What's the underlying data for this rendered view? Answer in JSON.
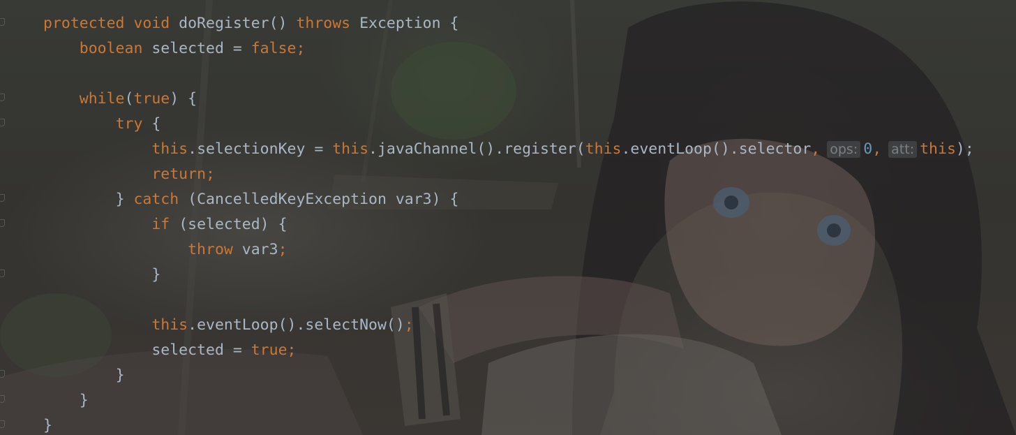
{
  "editor": {
    "colors": {
      "keyword": "#cc7832",
      "text": "#a9b7c6",
      "number": "#6897bb",
      "inlay_hint": "#7a8086",
      "background": "#2b2b2b"
    },
    "lines": [
      {
        "indent": "",
        "tokens": [
          {
            "t": "protected void ",
            "c": "kw"
          },
          {
            "t": "doRegister() ",
            "c": "plain"
          },
          {
            "t": "throws ",
            "c": "kw"
          },
          {
            "t": "Exception {",
            "c": "plain"
          }
        ]
      },
      {
        "indent": "    ",
        "tokens": [
          {
            "t": "boolean ",
            "c": "kw"
          },
          {
            "t": "selected = ",
            "c": "plain"
          },
          {
            "t": "false;",
            "c": "kw"
          }
        ]
      },
      {
        "indent": "",
        "tokens": []
      },
      {
        "indent": "    ",
        "tokens": [
          {
            "t": "while",
            "c": "kw"
          },
          {
            "t": "(",
            "c": "plain"
          },
          {
            "t": "true",
            "c": "kw"
          },
          {
            "t": ") {",
            "c": "plain"
          }
        ]
      },
      {
        "indent": "        ",
        "tokens": [
          {
            "t": "try ",
            "c": "kw"
          },
          {
            "t": "{",
            "c": "plain"
          }
        ]
      },
      {
        "indent": "            ",
        "tokens": [
          {
            "t": "this",
            "c": "kw"
          },
          {
            "t": ".selectionKey = ",
            "c": "plain"
          },
          {
            "t": "this",
            "c": "kw"
          },
          {
            "t": ".javaChannel().register(",
            "c": "plain"
          },
          {
            "t": "this",
            "c": "kw"
          },
          {
            "t": ".eventLoop().selector",
            "c": "plain"
          },
          {
            "t": ",",
            "c": "kw"
          },
          {
            "t": "ops:",
            "c": "hint"
          },
          {
            "t": "0",
            "c": "num"
          },
          {
            "t": ",",
            "c": "kw"
          },
          {
            "t": "att:",
            "c": "hint"
          },
          {
            "t": "this",
            "c": "kw"
          },
          {
            "t": ");",
            "c": "plain"
          }
        ]
      },
      {
        "indent": "            ",
        "tokens": [
          {
            "t": "return;",
            "c": "kw"
          }
        ]
      },
      {
        "indent": "        ",
        "tokens": [
          {
            "t": "} ",
            "c": "plain"
          },
          {
            "t": "catch ",
            "c": "kw"
          },
          {
            "t": "(CancelledKeyException var3) {",
            "c": "plain"
          }
        ]
      },
      {
        "indent": "            ",
        "tokens": [
          {
            "t": "if ",
            "c": "kw"
          },
          {
            "t": "(selected) {",
            "c": "plain"
          }
        ]
      },
      {
        "indent": "                ",
        "tokens": [
          {
            "t": "throw ",
            "c": "kw"
          },
          {
            "t": "var3",
            "c": "plain"
          },
          {
            "t": ";",
            "c": "kw"
          }
        ]
      },
      {
        "indent": "            ",
        "tokens": [
          {
            "t": "}",
            "c": "plain"
          }
        ]
      },
      {
        "indent": "",
        "tokens": []
      },
      {
        "indent": "            ",
        "tokens": [
          {
            "t": "this",
            "c": "kw"
          },
          {
            "t": ".eventLoop().selectNow()",
            "c": "plain"
          },
          {
            "t": ";",
            "c": "kw"
          }
        ]
      },
      {
        "indent": "            ",
        "tokens": [
          {
            "t": "selected = ",
            "c": "plain"
          },
          {
            "t": "true;",
            "c": "kw"
          }
        ]
      },
      {
        "indent": "        ",
        "tokens": [
          {
            "t": "}",
            "c": "plain"
          }
        ]
      },
      {
        "indent": "    ",
        "tokens": [
          {
            "t": "}",
            "c": "plain"
          }
        ]
      },
      {
        "indent": "",
        "tokens": [
          {
            "t": "}",
            "c": "plain"
          }
        ]
      }
    ]
  }
}
